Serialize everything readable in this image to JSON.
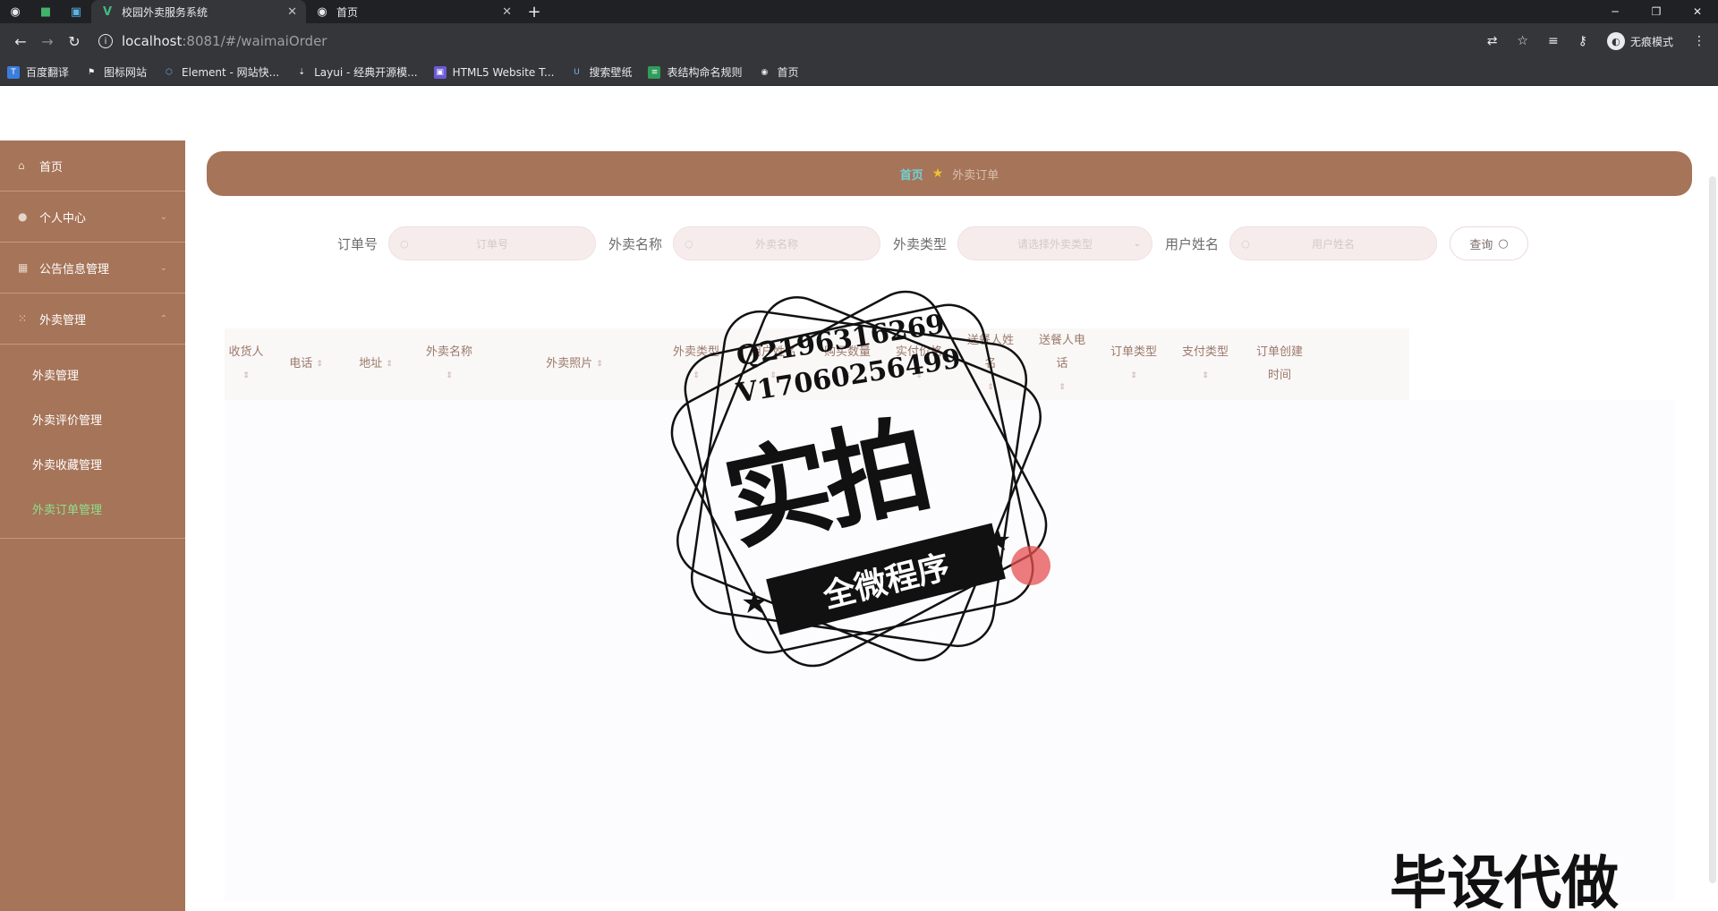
{
  "browser": {
    "tabs": [
      {
        "title": "校园外卖服务系统",
        "active": true
      },
      {
        "title": "首页",
        "active": false
      }
    ],
    "url_host": "localhost",
    "url_path": ":8081/#/waimaiOrder",
    "incognito_label": "无痕模式",
    "bookmarks": [
      "百度翻译",
      "图标网站",
      "Element - 网站快...",
      "Layui - 经典开源模...",
      "HTML5 Website T...",
      "搜索壁纸",
      "表结构命名规则",
      "首页"
    ]
  },
  "sidebar": {
    "items": [
      {
        "label": "首页",
        "icon": "home-icon"
      },
      {
        "label": "个人中心",
        "icon": "user-icon"
      },
      {
        "label": "公告信息管理",
        "icon": "notice-icon"
      },
      {
        "label": "外卖管理",
        "icon": "menu-icon"
      }
    ],
    "subitems": [
      {
        "label": "外卖管理",
        "active": false
      },
      {
        "label": "外卖评价管理",
        "active": false
      },
      {
        "label": "外卖收藏管理",
        "active": false
      },
      {
        "label": "外卖订单管理",
        "active": true
      }
    ]
  },
  "breadcrumb": {
    "home": "首页",
    "current": "外卖订单"
  },
  "search": {
    "fields": [
      {
        "label": "订单号",
        "placeholder": "订单号"
      },
      {
        "label": "外卖名称",
        "placeholder": "外卖名称"
      },
      {
        "label": "外卖类型",
        "placeholder": "请选择外卖类型"
      },
      {
        "label": "用户姓名",
        "placeholder": "用户姓名"
      }
    ],
    "button": "查询"
  },
  "table": {
    "columns": [
      "收货人",
      "电话",
      "地址",
      "外卖名称",
      "外卖照片",
      "外卖类型",
      "用户姓名",
      "购买数量",
      "实付价格",
      "送餐人姓名",
      "送餐人电话",
      "订单类型",
      "支付类型",
      "订单创建时间"
    ]
  },
  "watermark": {
    "qq": "Q2196316269",
    "wechat": "V17060256499",
    "big": "实拍",
    "ribbon": "全微程序",
    "corner": "毕设代做"
  }
}
